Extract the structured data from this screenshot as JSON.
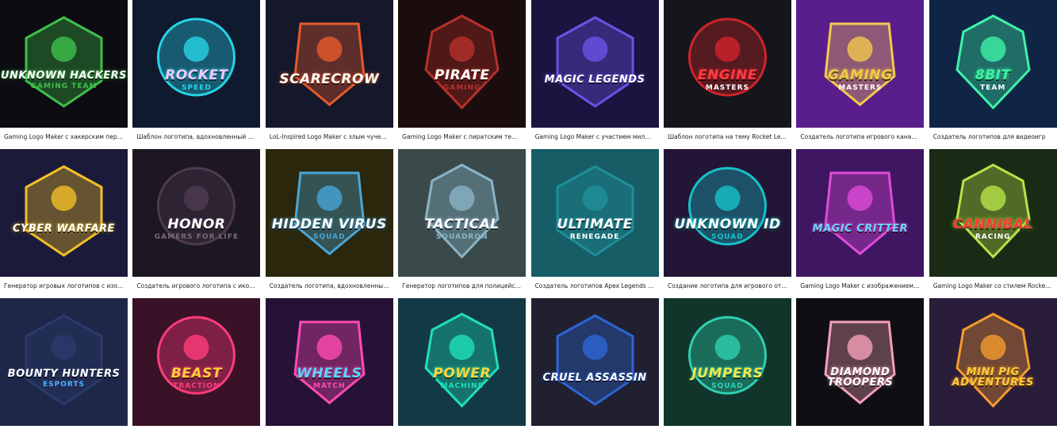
{
  "cards": [
    {
      "line1": "UNKNOWN HACKERS",
      "line2": "GAMING TEAM",
      "caption": "Gaming Logo Maker с хакерским персон…",
      "bg": "#0c0c12",
      "accent": "#3fbf4a",
      "text": "#ffffff",
      "sub": "#3fbf4a",
      "icon": "hacker-icon"
    },
    {
      "line1": "ROCKET",
      "line2": "SPEED",
      "caption": "Шаблон логотипа, вдохновленный Rock…",
      "bg": "#101a2e",
      "accent": "#27d3e8",
      "text": "#f0c8ff",
      "sub": "#27d3e8",
      "icon": "car-icon"
    },
    {
      "line1": "SCARECROW",
      "line2": "",
      "caption": "LoL-Inspired Logo Maker с злым чучелом",
      "bg": "#15172b",
      "accent": "#e65a2a",
      "text": "#ffffff",
      "sub": "#e65a2a",
      "icon": "scarecrow-icon"
    },
    {
      "line1": "PIRATE",
      "line2": "GAMING",
      "caption": "Gaming Logo Maker с пиратским темами",
      "bg": "#1b0d0e",
      "accent": "#b5312b",
      "text": "#ffffff",
      "sub": "#b5312b",
      "icon": "skull-icon"
    },
    {
      "line1": "MAGIC LEGENDS",
      "line2": "",
      "caption": "Gaming Logo Maker с участием милых …",
      "bg": "#1b1440",
      "accent": "#6a53e8",
      "text": "#ffffff",
      "sub": "#e89ad6",
      "icon": "axolotl-icon"
    },
    {
      "line1": "ENGINE",
      "line2": "MASTERS",
      "caption": "Шаблон логотипа на тему Rocket Leagu…",
      "bg": "#14161c",
      "accent": "#d2232a",
      "text": "#ff3b44",
      "sub": "#ffffff",
      "icon": "robot-icon"
    },
    {
      "line1": "GAMING",
      "line2": "MASTERS",
      "caption": "Создатель логотипа игрового канала с …",
      "bg": "#5a1d8c",
      "accent": "#f2c94c",
      "text": "#f2c94c",
      "sub": "#ffffff",
      "icon": "wrestler-icon"
    },
    {
      "line1": "8BIT",
      "line2": "TEAM",
      "caption": "Создатель логотипов для видеоигр",
      "bg": "#102546",
      "accent": "#3ff2a6",
      "text": "#3ff2a6",
      "sub": "#ffffff",
      "icon": "gamepad-icon"
    },
    {
      "line1": "CYBER WARFARE",
      "line2": "",
      "caption": "Генератор игровых логотипов с изобра…",
      "bg": "#1c1a3a",
      "accent": "#f2c026",
      "text": "#ffffff",
      "sub": "#f2c026",
      "icon": "cyborg-icon"
    },
    {
      "line1": "HONOR",
      "line2": "GAMERS FOR LIFE",
      "caption": "Создатель игрового логотипа с иконой …",
      "bg": "#1d1722",
      "accent": "#4d3a4f",
      "text": "#ffffff",
      "sub": "#7a6a7c",
      "icon": "medal-icon"
    },
    {
      "line1": "HIDDEN VIRUS",
      "line2": "SQUAD",
      "caption": "Создатель логотипа, вдохновленный ха…",
      "bg": "#2a270c",
      "accent": "#49a6d8",
      "text": "#ffffff",
      "sub": "#49a6d8",
      "icon": "hooded-figure-icon"
    },
    {
      "line1": "TACTICAL",
      "line2": "SQUADRON",
      "caption": "Генератор логотипов для полицейской …",
      "bg": "#3a4a4b",
      "accent": "#8ab4c8",
      "text": "#ffffff",
      "sub": "#8ab4c8",
      "icon": "badge-icon"
    },
    {
      "line1": "ULTIMATE",
      "line2": "RENEGADE",
      "caption": "Создатель логотипов Apex Legends с же…",
      "bg": "#165d66",
      "accent": "#1f8f9a",
      "text": "#ffffff",
      "sub": "#ffffff",
      "icon": "warrior-icon"
    },
    {
      "line1": "UNKNOWN ID",
      "line2": "SQUAD",
      "caption": "Создание логотипа для игрового отряда…",
      "bg": "#221535",
      "accent": "#15c2c9",
      "text": "#ffffff",
      "sub": "#15c2c9",
      "icon": "hooded-figure-icon"
    },
    {
      "line1": "MAGIC CRITTER",
      "line2": "",
      "caption": "Gaming Logo Maker с изображением му…",
      "bg": "#3e1661",
      "accent": "#e04bd8",
      "text": "#6bd3ff",
      "sub": "#e04bd8",
      "icon": "critter-icon"
    },
    {
      "line1": "CANNIBAL",
      "line2": "RACING",
      "caption": "Gaming Logo Maker со стилем Rocket Le…",
      "bg": "#1a2b15",
      "accent": "#b6e34a",
      "text": "#ff3b3b",
      "sub": "#ffffff",
      "icon": "truck-icon"
    },
    {
      "line1": "BOUNTY HUNTERS",
      "line2": "ESPORTS",
      "caption": "",
      "bg": "#1e2748",
      "accent": "#2a3a6a",
      "text": "#ffffff",
      "sub": "#4bb3ff",
      "icon": "rifle-icon"
    },
    {
      "line1": "BEAST",
      "line2": "TRACTION",
      "caption": "",
      "bg": "#3a1228",
      "accent": "#ff3c7a",
      "text": "#ffcf33",
      "sub": "#ff3c7a",
      "icon": "car-icon"
    },
    {
      "line1": "WHEELS",
      "line2": "MATCH",
      "caption": "",
      "bg": "#261236",
      "accent": "#ff4bb3",
      "text": "#58d6ff",
      "sub": "#ff4bb3",
      "icon": "car-icon"
    },
    {
      "line1": "POWER",
      "line2": "MACHINE",
      "caption": "",
      "bg": "#123a44",
      "accent": "#1fe0b6",
      "text": "#ffd53b",
      "sub": "#1fe0b6",
      "icon": "helmet-icon"
    },
    {
      "line1": "CRUEL ASSASSIN",
      "line2": "",
      "caption": "",
      "bg": "#202030",
      "accent": "#2d66d6",
      "text": "#ffffff",
      "sub": "#2d66d6",
      "icon": "ninja-icon"
    },
    {
      "line1": "JUMPERS",
      "line2": "SQUAD",
      "caption": "",
      "bg": "#11352a",
      "accent": "#2ed0b2",
      "text": "#f2e84c",
      "sub": "#2ed0b2",
      "icon": "car-icon"
    },
    {
      "line1": "DIAMOND TROOPERS",
      "line2": "",
      "caption": "",
      "bg": "#0e0e14",
      "accent": "#f4a0b8",
      "text": "#ffffff",
      "sub": "#f4a0b8",
      "icon": "soldier-icon"
    },
    {
      "line1": "MINI PIG ADVENTURES",
      "line2": "",
      "caption": "",
      "bg": "#2a1d3a",
      "accent": "#f59b2d",
      "text": "#ffcc3d",
      "sub": "#f07aa0",
      "icon": "pig-icon"
    }
  ]
}
